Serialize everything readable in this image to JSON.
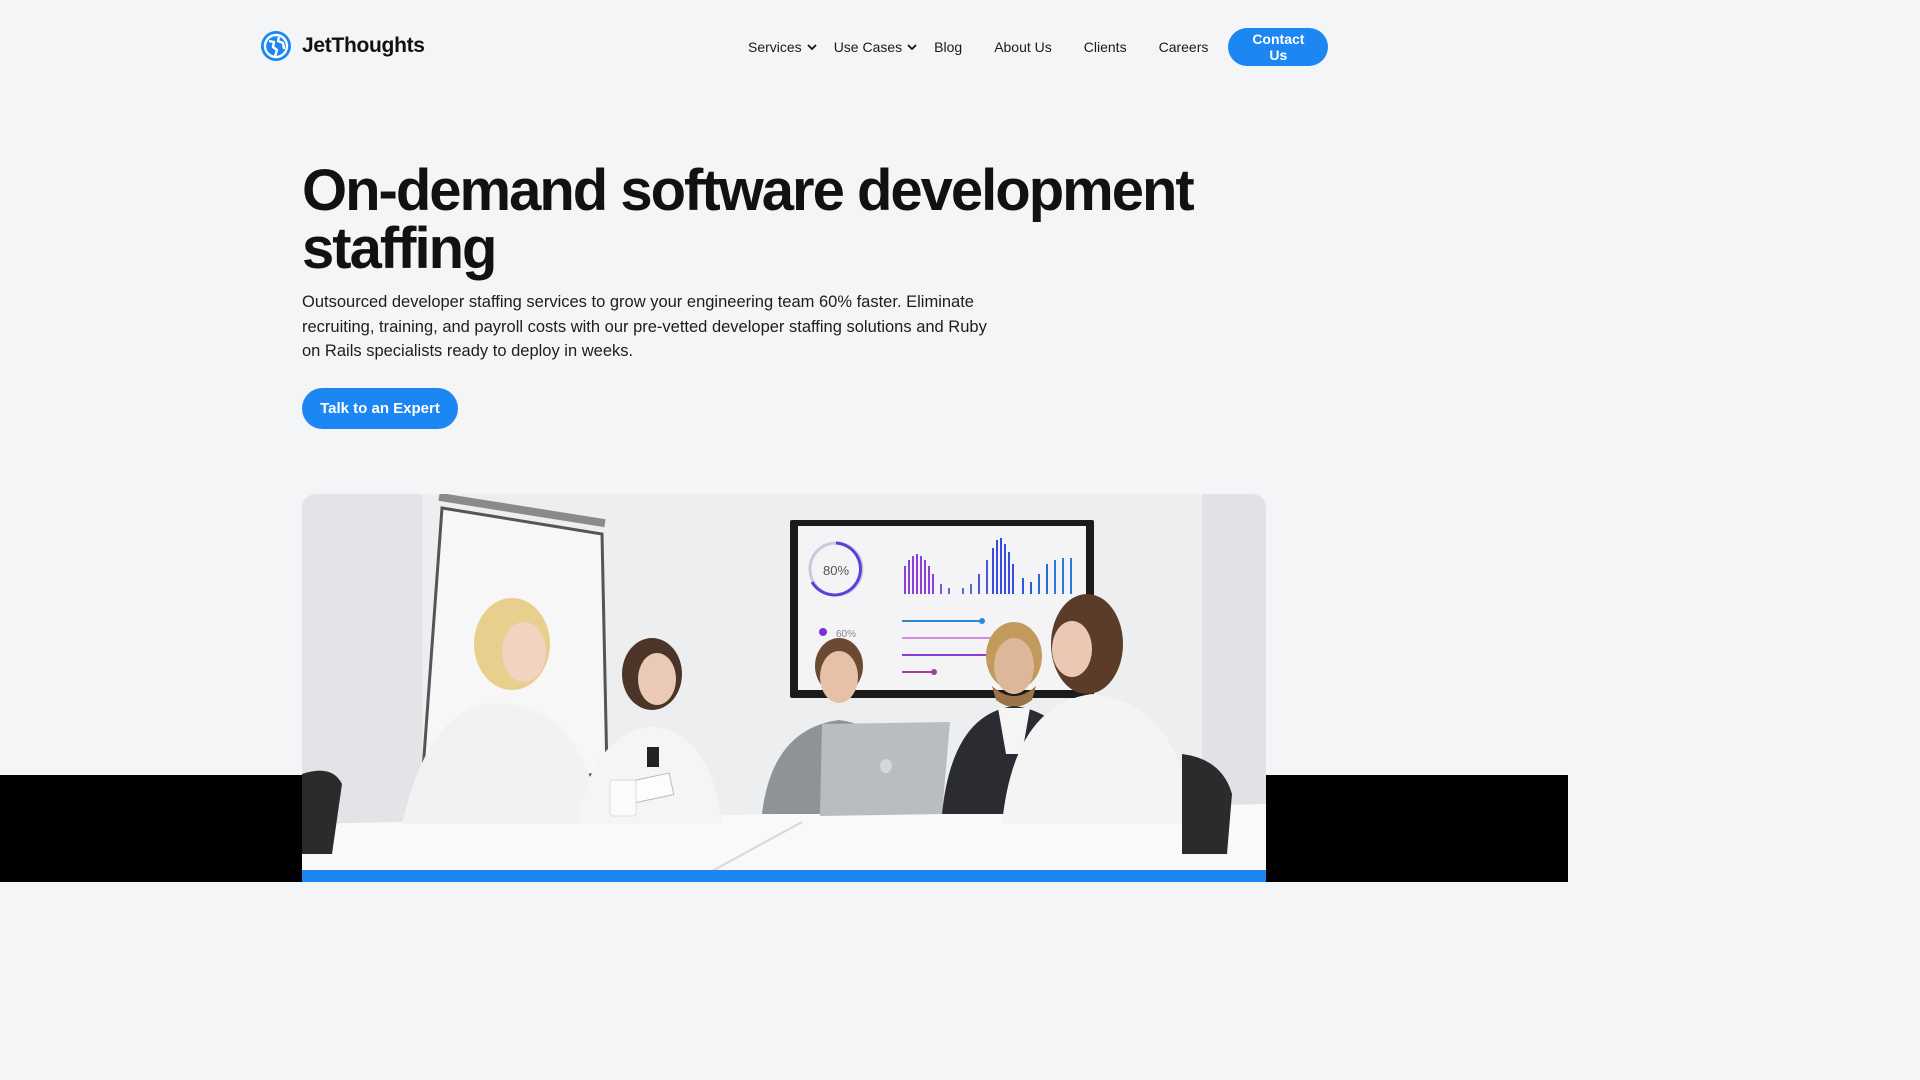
{
  "brand": {
    "name": "JetThoughts",
    "logo_icon": "globe-logo-icon",
    "accent_color": "#1c86f2"
  },
  "nav": {
    "services": "Services",
    "use_cases": "Use Cases",
    "blog": "Blog",
    "about": "About Us",
    "clients": "Clients",
    "careers": "Careers",
    "contact": "Contact Us"
  },
  "hero": {
    "title": "On-demand software development staffing",
    "subtitle": "Outsourced developer staffing services to grow your engineering team 60% faster. Eliminate recruiting, training, and payroll costs with our pre-vetted developer staffing solutions and Ruby on Rails specialists ready to deploy in weeks.",
    "cta": "Talk to an Expert"
  },
  "image": {
    "screen_percent": "80%",
    "screen_legend": "60%"
  }
}
